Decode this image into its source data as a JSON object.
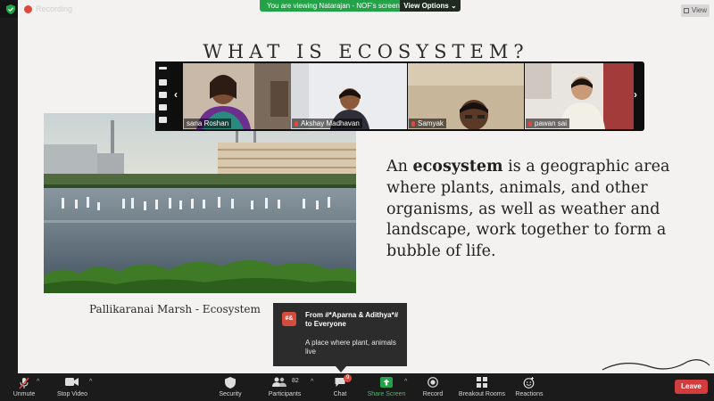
{
  "app": {
    "recording_label": "Recording",
    "viewing_banner": "You are viewing Natarajan - NOF's screen",
    "view_options_label": "View Options ⌄",
    "view_button_label": "View"
  },
  "slide": {
    "title": "WHAT IS ECOSYSTEM?",
    "photo_caption": "Pallikaranai Marsh - Ecosystem",
    "definition_before": "An ",
    "definition_keyword": "ecosystem",
    "definition_after": " is a geographic area where plants, animals, and other organisms, as well as weather and landscape, work together to form a bubble of life."
  },
  "video_strip": {
    "participants": [
      {
        "name": "sana Roshan",
        "muted": false
      },
      {
        "name": "Akshay Madhavan",
        "muted": true
      },
      {
        "name": "Samyak",
        "muted": true
      },
      {
        "name": "pawan sai",
        "muted": true
      }
    ]
  },
  "chat_popup": {
    "avatar_text": "#&",
    "from": "From #*Aparna & Adithya*# to Everyone",
    "message": "A place where plant, animals live"
  },
  "toolbar": {
    "unmute": "Unmute",
    "stop_video": "Stop Video",
    "security": "Security",
    "participants": "Participants",
    "participants_count": "82",
    "chat": "Chat",
    "chat_badge": "9",
    "share_screen": "Share Screen",
    "record": "Record",
    "breakout_rooms": "Breakout Rooms",
    "reactions": "Reactions",
    "leave": "Leave"
  },
  "colors": {
    "share_green": "#23a347",
    "leave_red": "#d13c3c",
    "slide_background": "#f4f1f1"
  }
}
